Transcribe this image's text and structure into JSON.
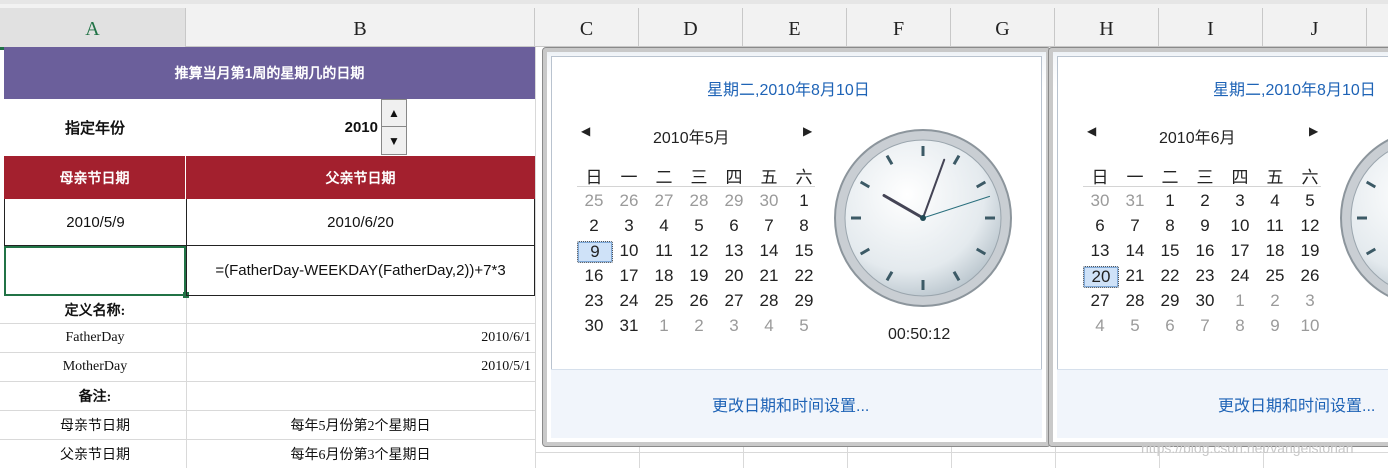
{
  "columns": [
    "A",
    "B",
    "C",
    "D",
    "E",
    "F",
    "G",
    "H",
    "I",
    "J"
  ],
  "sheet": {
    "title": "推算当月第1周的星期几的日期",
    "year_label": "指定年份",
    "year_value": "2010",
    "mother_header": "母亲节日期",
    "father_header": "父亲节日期",
    "mother_date": "2010/5/9",
    "father_date": "2010/6/20",
    "formula": "=(FatherDay-WEEKDAY(FatherDay,2))+7*3",
    "define_label": "定义名称:",
    "name1": "FatherDay",
    "name1_value": "2010/6/1",
    "name2": "MotherDay",
    "name2_value": "2010/5/1",
    "note_label": "备注:",
    "note1_label": "母亲节日期",
    "note1_value": "每年5月份第2个星期日",
    "note2_label": "父亲节日期",
    "note2_value": "每年6月份第3个星期日",
    "spin_up": "▲",
    "spin_down": "▼",
    "colors": {
      "title_bg": "#6b5f9b",
      "header_bg": "#a3202e",
      "grid": "#d9d9d9",
      "selected": "#217346"
    }
  },
  "calendars": [
    {
      "title": "星期二,2010年8月10日",
      "month": "2010年5月",
      "weekdays": [
        "日",
        "一",
        "二",
        "三",
        "四",
        "五",
        "六"
      ],
      "weeks": [
        [
          "25",
          "26",
          "27",
          "28",
          "29",
          "30",
          "1"
        ],
        [
          "2",
          "3",
          "4",
          "5",
          "6",
          "7",
          "8"
        ],
        [
          "9",
          "10",
          "11",
          "12",
          "13",
          "14",
          "15"
        ],
        [
          "16",
          "17",
          "18",
          "19",
          "20",
          "21",
          "22"
        ],
        [
          "23",
          "24",
          "25",
          "26",
          "27",
          "28",
          "29"
        ],
        [
          "30",
          "31",
          "1",
          "2",
          "3",
          "4",
          "5"
        ]
      ],
      "selected_day": "9",
      "time": "00:50:12",
      "footer_link": "更改日期和时间设置..."
    },
    {
      "title": "星期二,2010年8月10日",
      "month": "2010年6月",
      "weekdays": [
        "日",
        "一",
        "二",
        "三",
        "四",
        "五",
        "六"
      ],
      "weeks": [
        [
          "30",
          "31",
          "1",
          "2",
          "3",
          "4",
          "5"
        ],
        [
          "6",
          "7",
          "8",
          "9",
          "10",
          "11",
          "12"
        ],
        [
          "13",
          "14",
          "15",
          "16",
          "17",
          "18",
          "19"
        ],
        [
          "20",
          "21",
          "22",
          "23",
          "24",
          "25",
          "26"
        ],
        [
          "27",
          "28",
          "29",
          "30",
          "1",
          "2",
          "3"
        ],
        [
          "4",
          "5",
          "6",
          "7",
          "8",
          "9",
          "10"
        ]
      ],
      "selected_day": "20",
      "footer_link": "更改日期和时间设置..."
    }
  ],
  "icons": {
    "prev": "triangle-left-icon",
    "next": "triangle-right-icon",
    "clock": "analog-clock-icon"
  },
  "watermark": "https://blog.csdn.net/vangelstonan"
}
